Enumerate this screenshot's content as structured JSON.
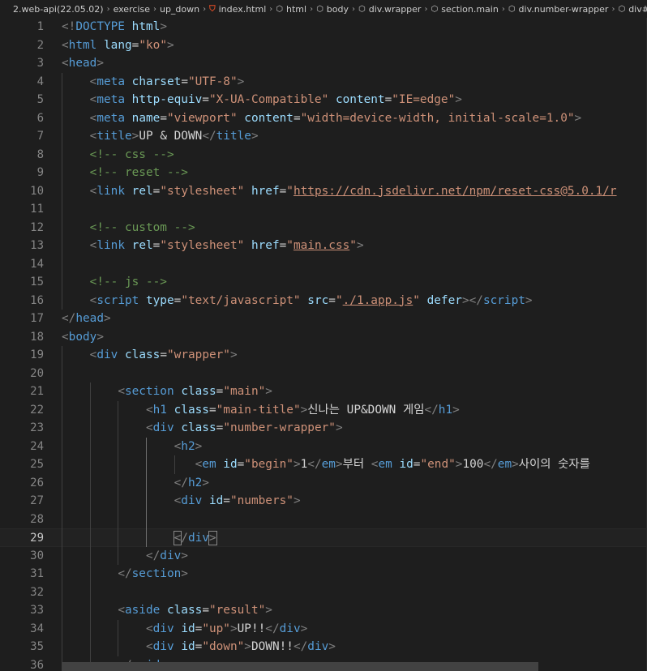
{
  "breadcrumb": {
    "items": [
      {
        "label": "2.web-api(22.05.02)",
        "icon": ""
      },
      {
        "label": "exercise",
        "icon": ""
      },
      {
        "label": "up_down",
        "icon": ""
      },
      {
        "label": "index.html",
        "icon": "html5-icon"
      },
      {
        "label": "html",
        "icon": "symbol-icon"
      },
      {
        "label": "body",
        "icon": "symbol-icon"
      },
      {
        "label": "div.wrapper",
        "icon": "symbol-icon"
      },
      {
        "label": "section.main",
        "icon": "symbol-icon"
      },
      {
        "label": "div.number-wrapper",
        "icon": "symbol-icon"
      },
      {
        "label": "div#numbers",
        "icon": "symbol-icon"
      }
    ],
    "separator": "›"
  },
  "editor": {
    "current_line": 29,
    "colors": {
      "background": "#1e1e1e",
      "tag": "#569cd6",
      "attribute": "#9cdcfe",
      "string": "#ce9178",
      "comment": "#6a9955",
      "punctuation": "#808080",
      "text": "#d4d4d4",
      "line_number": "#858585"
    },
    "lines": [
      {
        "num": "1",
        "tokens": [
          [
            "punct",
            "<!"
          ],
          [
            "tag",
            "DOCTYPE"
          ],
          [
            "text",
            " "
          ],
          [
            "attr",
            "html"
          ],
          [
            "punct",
            ">"
          ]
        ]
      },
      {
        "num": "2",
        "tokens": [
          [
            "punct",
            "<"
          ],
          [
            "tag",
            "html"
          ],
          [
            "text",
            " "
          ],
          [
            "attr",
            "lang"
          ],
          [
            "text",
            "="
          ],
          [
            "str",
            "\"ko\""
          ],
          [
            "punct",
            ">"
          ]
        ]
      },
      {
        "num": "3",
        "tokens": [
          [
            "punct",
            "<"
          ],
          [
            "tag",
            "head"
          ],
          [
            "punct",
            ">"
          ]
        ]
      },
      {
        "num": "4",
        "tokens": [
          [
            "text",
            "    "
          ],
          [
            "punct",
            "<"
          ],
          [
            "tag",
            "meta"
          ],
          [
            "text",
            " "
          ],
          [
            "attr",
            "charset"
          ],
          [
            "text",
            "="
          ],
          [
            "str",
            "\"UTF-8\""
          ],
          [
            "punct",
            ">"
          ]
        ]
      },
      {
        "num": "5",
        "tokens": [
          [
            "text",
            "    "
          ],
          [
            "punct",
            "<"
          ],
          [
            "tag",
            "meta"
          ],
          [
            "text",
            " "
          ],
          [
            "attr",
            "http-equiv"
          ],
          [
            "text",
            "="
          ],
          [
            "str",
            "\"X-UA-Compatible\""
          ],
          [
            "text",
            " "
          ],
          [
            "attr",
            "content"
          ],
          [
            "text",
            "="
          ],
          [
            "str",
            "\"IE=edge\""
          ],
          [
            "punct",
            ">"
          ]
        ]
      },
      {
        "num": "6",
        "tokens": [
          [
            "text",
            "    "
          ],
          [
            "punct",
            "<"
          ],
          [
            "tag",
            "meta"
          ],
          [
            "text",
            " "
          ],
          [
            "attr",
            "name"
          ],
          [
            "text",
            "="
          ],
          [
            "str",
            "\"viewport\""
          ],
          [
            "text",
            " "
          ],
          [
            "attr",
            "content"
          ],
          [
            "text",
            "="
          ],
          [
            "str",
            "\"width=device-width, initial-scale=1.0\""
          ],
          [
            "punct",
            ">"
          ]
        ]
      },
      {
        "num": "7",
        "tokens": [
          [
            "text",
            "    "
          ],
          [
            "punct",
            "<"
          ],
          [
            "tag",
            "title"
          ],
          [
            "punct",
            ">"
          ],
          [
            "text",
            "UP & DOWN"
          ],
          [
            "punct",
            "</"
          ],
          [
            "tag",
            "title"
          ],
          [
            "punct",
            ">"
          ]
        ]
      },
      {
        "num": "8",
        "tokens": [
          [
            "text",
            "    "
          ],
          [
            "cpunct",
            "<!--"
          ],
          [
            "comment",
            " css "
          ],
          [
            "cpunct",
            "-->"
          ]
        ]
      },
      {
        "num": "9",
        "tokens": [
          [
            "text",
            "    "
          ],
          [
            "cpunct",
            "<!--"
          ],
          [
            "comment",
            " reset "
          ],
          [
            "cpunct",
            "-->"
          ]
        ]
      },
      {
        "num": "10",
        "tokens": [
          [
            "text",
            "    "
          ],
          [
            "punct",
            "<"
          ],
          [
            "tag",
            "link"
          ],
          [
            "text",
            " "
          ],
          [
            "attr",
            "rel"
          ],
          [
            "text",
            "="
          ],
          [
            "str",
            "\"stylesheet\""
          ],
          [
            "text",
            " "
          ],
          [
            "attr",
            "href"
          ],
          [
            "text",
            "="
          ],
          [
            "str",
            "\""
          ],
          [
            "link",
            "https://cdn.jsdelivr.net/npm/reset-css@5.0.1/r"
          ]
        ]
      },
      {
        "num": "11",
        "tokens": []
      },
      {
        "num": "12",
        "tokens": [
          [
            "text",
            "    "
          ],
          [
            "cpunct",
            "<!--"
          ],
          [
            "comment",
            " custom "
          ],
          [
            "cpunct",
            "-->"
          ]
        ]
      },
      {
        "num": "13",
        "tokens": [
          [
            "text",
            "    "
          ],
          [
            "punct",
            "<"
          ],
          [
            "tag",
            "link"
          ],
          [
            "text",
            " "
          ],
          [
            "attr",
            "rel"
          ],
          [
            "text",
            "="
          ],
          [
            "str",
            "\"stylesheet\""
          ],
          [
            "text",
            " "
          ],
          [
            "attr",
            "href"
          ],
          [
            "text",
            "="
          ],
          [
            "str",
            "\""
          ],
          [
            "link",
            "main.css"
          ],
          [
            "str",
            "\""
          ],
          [
            "punct",
            ">"
          ]
        ]
      },
      {
        "num": "14",
        "tokens": []
      },
      {
        "num": "15",
        "tokens": [
          [
            "text",
            "    "
          ],
          [
            "cpunct",
            "<!--"
          ],
          [
            "comment",
            " js "
          ],
          [
            "cpunct",
            "-->"
          ]
        ]
      },
      {
        "num": "16",
        "tokens": [
          [
            "text",
            "    "
          ],
          [
            "punct",
            "<"
          ],
          [
            "tag",
            "script"
          ],
          [
            "text",
            " "
          ],
          [
            "attr",
            "type"
          ],
          [
            "text",
            "="
          ],
          [
            "str",
            "\"text/javascript\""
          ],
          [
            "text",
            " "
          ],
          [
            "attr",
            "src"
          ],
          [
            "text",
            "="
          ],
          [
            "str",
            "\""
          ],
          [
            "link",
            "./1.app.js"
          ],
          [
            "str",
            "\""
          ],
          [
            "text",
            " "
          ],
          [
            "attr",
            "defer"
          ],
          [
            "punct",
            "></"
          ],
          [
            "tag",
            "script"
          ],
          [
            "punct",
            ">"
          ]
        ]
      },
      {
        "num": "17",
        "tokens": [
          [
            "punct",
            "</"
          ],
          [
            "tag",
            "head"
          ],
          [
            "punct",
            ">"
          ]
        ]
      },
      {
        "num": "18",
        "tokens": [
          [
            "punct",
            "<"
          ],
          [
            "tag",
            "body"
          ],
          [
            "punct",
            ">"
          ]
        ]
      },
      {
        "num": "19",
        "tokens": [
          [
            "text",
            "    "
          ],
          [
            "punct",
            "<"
          ],
          [
            "tag",
            "div"
          ],
          [
            "text",
            " "
          ],
          [
            "attr",
            "class"
          ],
          [
            "text",
            "="
          ],
          [
            "str",
            "\"wrapper\""
          ],
          [
            "punct",
            ">"
          ]
        ]
      },
      {
        "num": "20",
        "tokens": []
      },
      {
        "num": "21",
        "tokens": [
          [
            "text",
            "        "
          ],
          [
            "punct",
            "<"
          ],
          [
            "tag",
            "section"
          ],
          [
            "text",
            " "
          ],
          [
            "attr",
            "class"
          ],
          [
            "text",
            "="
          ],
          [
            "str",
            "\"main\""
          ],
          [
            "punct",
            ">"
          ]
        ]
      },
      {
        "num": "22",
        "tokens": [
          [
            "text",
            "            "
          ],
          [
            "punct",
            "<"
          ],
          [
            "tag",
            "h1"
          ],
          [
            "text",
            " "
          ],
          [
            "attr",
            "class"
          ],
          [
            "text",
            "="
          ],
          [
            "str",
            "\"main-title\""
          ],
          [
            "punct",
            ">"
          ],
          [
            "text",
            "신나는 UP&DOWN 게임"
          ],
          [
            "punct",
            "</"
          ],
          [
            "tag",
            "h1"
          ],
          [
            "punct",
            ">"
          ]
        ]
      },
      {
        "num": "23",
        "tokens": [
          [
            "text",
            "            "
          ],
          [
            "punct",
            "<"
          ],
          [
            "tag",
            "div"
          ],
          [
            "text",
            " "
          ],
          [
            "attr",
            "class"
          ],
          [
            "text",
            "="
          ],
          [
            "str",
            "\"number-wrapper\""
          ],
          [
            "punct",
            ">"
          ]
        ]
      },
      {
        "num": "24",
        "tokens": [
          [
            "text",
            "                "
          ],
          [
            "punct",
            "<"
          ],
          [
            "tag",
            "h2"
          ],
          [
            "punct",
            ">"
          ]
        ]
      },
      {
        "num": "25",
        "tokens": [
          [
            "text",
            "                   "
          ],
          [
            "punct",
            "<"
          ],
          [
            "tag",
            "em"
          ],
          [
            "text",
            " "
          ],
          [
            "attr",
            "id"
          ],
          [
            "text",
            "="
          ],
          [
            "str",
            "\"begin\""
          ],
          [
            "punct",
            ">"
          ],
          [
            "text",
            "1"
          ],
          [
            "punct",
            "</"
          ],
          [
            "tag",
            "em"
          ],
          [
            "punct",
            ">"
          ],
          [
            "text",
            "부터 "
          ],
          [
            "punct",
            "<"
          ],
          [
            "tag",
            "em"
          ],
          [
            "text",
            " "
          ],
          [
            "attr",
            "id"
          ],
          [
            "text",
            "="
          ],
          [
            "str",
            "\"end\""
          ],
          [
            "punct",
            ">"
          ],
          [
            "text",
            "100"
          ],
          [
            "punct",
            "</"
          ],
          [
            "tag",
            "em"
          ],
          [
            "punct",
            ">"
          ],
          [
            "text",
            "사이의 숫자를"
          ]
        ]
      },
      {
        "num": "26",
        "tokens": [
          [
            "text",
            "                "
          ],
          [
            "punct",
            "</"
          ],
          [
            "tag",
            "h2"
          ],
          [
            "punct",
            ">"
          ]
        ]
      },
      {
        "num": "27",
        "tokens": [
          [
            "text",
            "                "
          ],
          [
            "punct",
            "<"
          ],
          [
            "tag",
            "div"
          ],
          [
            "text",
            " "
          ],
          [
            "attr",
            "id"
          ],
          [
            "text",
            "="
          ],
          [
            "str",
            "\"numbers\""
          ],
          [
            "punct",
            ">"
          ]
        ]
      },
      {
        "num": "28",
        "tokens": []
      },
      {
        "num": "29",
        "tokens": [
          [
            "text",
            "                "
          ],
          [
            "bracket",
            "<"
          ],
          [
            "punct",
            "/"
          ],
          [
            "tag",
            "div"
          ],
          [
            "bracket",
            ">"
          ]
        ]
      },
      {
        "num": "30",
        "tokens": [
          [
            "text",
            "            "
          ],
          [
            "punct",
            "</"
          ],
          [
            "tag",
            "div"
          ],
          [
            "punct",
            ">"
          ]
        ]
      },
      {
        "num": "31",
        "tokens": [
          [
            "text",
            "        "
          ],
          [
            "punct",
            "</"
          ],
          [
            "tag",
            "section"
          ],
          [
            "punct",
            ">"
          ]
        ]
      },
      {
        "num": "32",
        "tokens": []
      },
      {
        "num": "33",
        "tokens": [
          [
            "text",
            "        "
          ],
          [
            "punct",
            "<"
          ],
          [
            "tag",
            "aside"
          ],
          [
            "text",
            " "
          ],
          [
            "attr",
            "class"
          ],
          [
            "text",
            "="
          ],
          [
            "str",
            "\"result\""
          ],
          [
            "punct",
            ">"
          ]
        ]
      },
      {
        "num": "34",
        "tokens": [
          [
            "text",
            "            "
          ],
          [
            "punct",
            "<"
          ],
          [
            "tag",
            "div"
          ],
          [
            "text",
            " "
          ],
          [
            "attr",
            "id"
          ],
          [
            "text",
            "="
          ],
          [
            "str",
            "\"up\""
          ],
          [
            "punct",
            ">"
          ],
          [
            "text",
            "UP!!"
          ],
          [
            "punct",
            "</"
          ],
          [
            "tag",
            "div"
          ],
          [
            "punct",
            ">"
          ]
        ]
      },
      {
        "num": "35",
        "tokens": [
          [
            "text",
            "            "
          ],
          [
            "punct",
            "<"
          ],
          [
            "tag",
            "div"
          ],
          [
            "text",
            " "
          ],
          [
            "attr",
            "id"
          ],
          [
            "text",
            "="
          ],
          [
            "str",
            "\"down\""
          ],
          [
            "punct",
            ">"
          ],
          [
            "text",
            "DOWN!!"
          ],
          [
            "punct",
            "</"
          ],
          [
            "tag",
            "div"
          ],
          [
            "punct",
            ">"
          ]
        ]
      },
      {
        "num": "36",
        "tokens": [
          [
            "text",
            "        "
          ],
          [
            "punct",
            "</"
          ],
          [
            "tag",
            "aside"
          ],
          [
            "punct",
            ">"
          ]
        ]
      }
    ]
  }
}
